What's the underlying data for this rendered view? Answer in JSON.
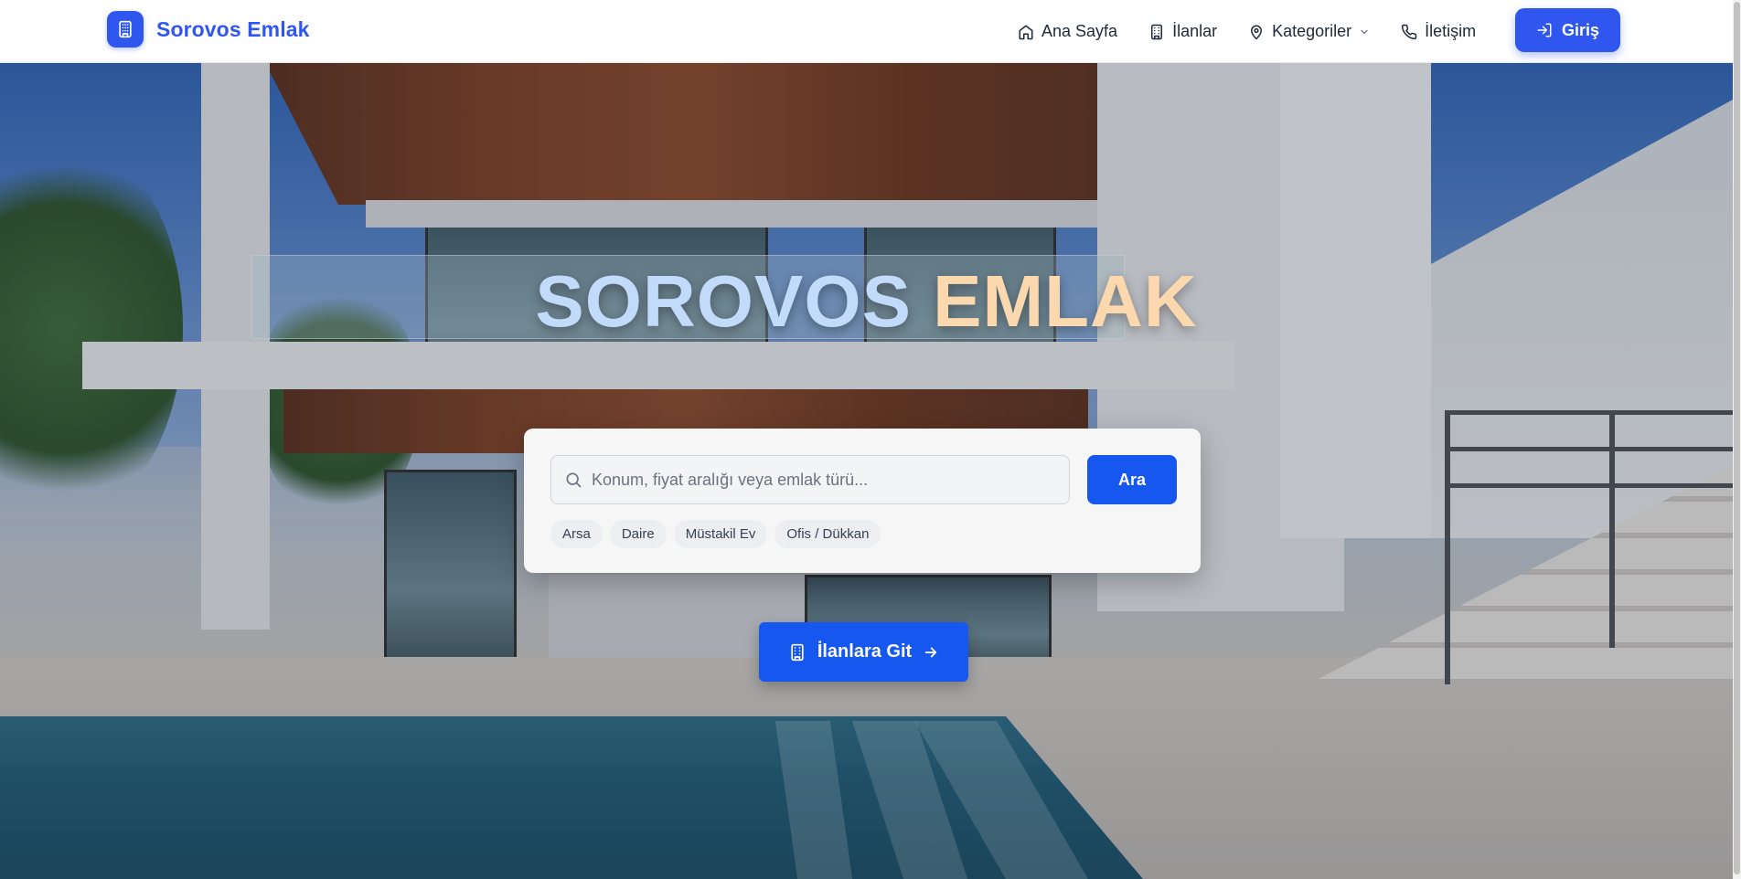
{
  "brand": {
    "name": "Sorovos Emlak",
    "icon": "building-icon",
    "color": "#2f57f0"
  },
  "nav": {
    "items": [
      {
        "label": "Ana Sayfa",
        "icon": "home-icon"
      },
      {
        "label": "İlanlar",
        "icon": "building-icon"
      },
      {
        "label": "Kategoriler",
        "icon": "map-pin-icon",
        "dropdown": true
      },
      {
        "label": "İletişim",
        "icon": "phone-icon"
      }
    ],
    "login": {
      "label": "Giriş",
      "icon": "login-icon"
    }
  },
  "hero": {
    "title_word1": "SOROVOS",
    "title_word2": "EMLAK",
    "title_colors": [
      "#c3dbfb",
      "#fcd8ae"
    ]
  },
  "search": {
    "placeholder": "Konum, fiyat aralığı veya emlak türü...",
    "value": "",
    "button_label": "Ara",
    "chips": [
      "Arsa",
      "Daire",
      "Müstakil Ev",
      "Ofis / Dükkan"
    ]
  },
  "cta": {
    "label": "İlanlara Git",
    "icon": "building-icon",
    "arrow": "arrow-right-icon",
    "color": "#1657f0"
  }
}
